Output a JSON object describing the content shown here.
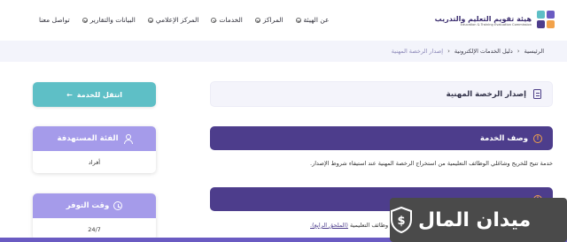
{
  "header": {
    "logo_ar": "هيئة تقويم التعليم والتدريب",
    "logo_en": "Education & Training Evaluation Commission",
    "nav": [
      {
        "label": "عن الهيئة",
        "icon": "chevron-down-icon"
      },
      {
        "label": "المراكز",
        "icon": "chevron-down-icon"
      },
      {
        "label": "الخدمات",
        "icon": "chevron-down-icon"
      },
      {
        "label": "المركز الإعلامي",
        "icon": "chevron-down-icon"
      },
      {
        "label": "البيانات والتقارير",
        "icon": "chevron-down-icon"
      },
      {
        "label": "تواصل معنا"
      }
    ]
  },
  "breadcrumb": {
    "items": [
      "الرئيسية",
      "دليل الخدمات الإلكترونية",
      "إصدار الرخصة المهنية"
    ]
  },
  "main": {
    "title": "إصدار الرخصة المهنية",
    "description_title": "وصف الخدمة",
    "description_text": "خدمة تتيح للخريج وشاغلي الوظائف التعليمية من استخراج الرخصة المهنية عند استيفاء شروط الإصدار.",
    "second_text_prefix": "وظائف التعليمية",
    "second_text_link": "(الملحق الرابع)."
  },
  "side": {
    "cta_label": "انتقل للخدمة",
    "audience_title": "الفئة المستهدفة",
    "audience_value": "أفراد",
    "availability_title": "وقت التوفر",
    "availability_value": "24/7"
  },
  "watermark": {
    "text": "ميدان المال"
  },
  "colors": {
    "primary": "#4d3d8c",
    "accent_teal": "#5ebfc6",
    "side_head": "#a59bea",
    "info_orange": "#f2a24a"
  }
}
